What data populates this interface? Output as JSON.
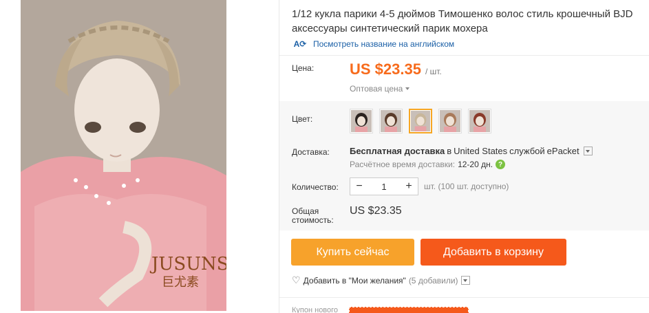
{
  "product": {
    "title": "1/12 кукла парики 4-5 дюймов Тимошенко волос стиль крошечный BJD аксессуары синтетический парик мохера",
    "translate_link": "Посмотреть название на английском",
    "translate_icon": "translate-icon",
    "image_brand": "JUSUNS",
    "image_brand_cn": "巨尤素"
  },
  "price": {
    "label": "Цена:",
    "amount": "US $23.35",
    "unit": "/ шт.",
    "wholesale": "Оптовая цена"
  },
  "color": {
    "label": "Цвет:",
    "selected_index": 2,
    "swatches": [
      "dark",
      "brown",
      "blonde",
      "auburn",
      "red"
    ]
  },
  "shipping": {
    "label": "Доставка:",
    "free": "Бесплатная доставка",
    "to": "в",
    "country": "United States",
    "via": "службой",
    "carrier": "ePacket",
    "eta_label": "Расчётное время доставки:",
    "eta_value": "12-20 дн."
  },
  "quantity": {
    "label": "Количество:",
    "value": "1",
    "minus": "−",
    "plus": "+",
    "info": "шт. (100 шт. доступно)"
  },
  "total": {
    "label_line1": "Общая",
    "label_line2": "стоимость:",
    "value": "US $23.35"
  },
  "actions": {
    "buy_now": "Купить сейчас",
    "add_to_cart": "Добавить в корзину"
  },
  "wishlist": {
    "text": "Добавить в \"Мои желания\"",
    "count": "(5 добавили)"
  },
  "coupon": {
    "label": "Купон нового"
  },
  "colors": {
    "accent_orange": "#f76b1c",
    "buy_button": "#f7a22b",
    "cart_button": "#f5591b",
    "link_blue": "#1a5fa6",
    "selected_border": "#f6a623"
  }
}
